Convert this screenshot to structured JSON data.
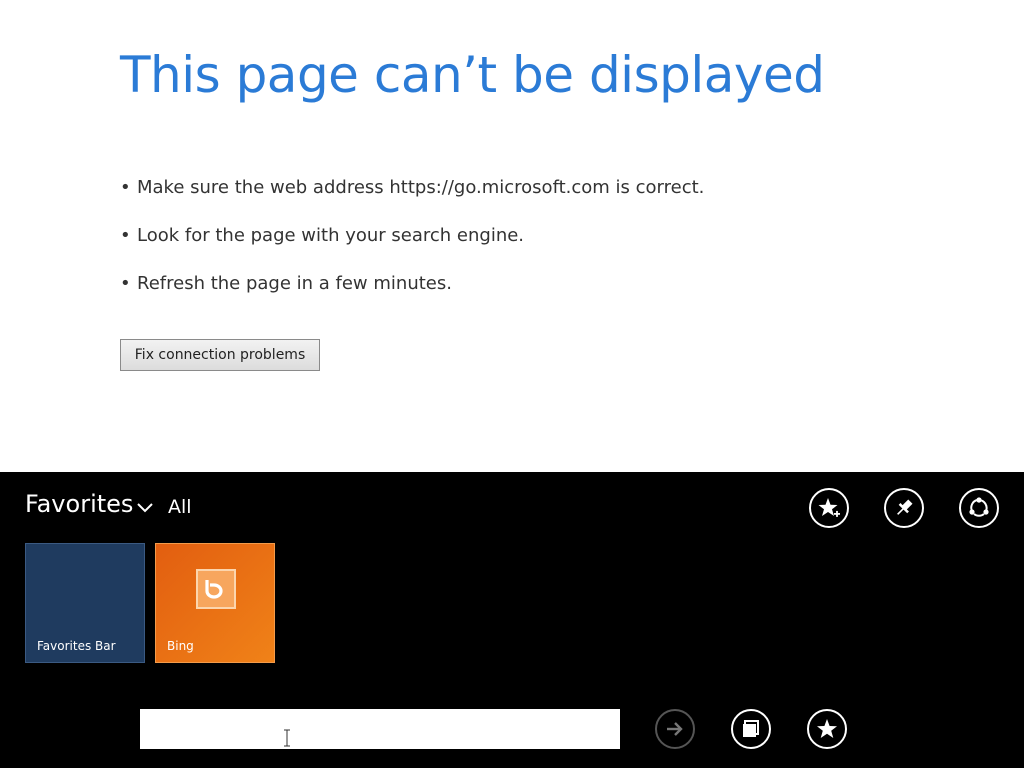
{
  "error": {
    "title": "This page can’t be displayed",
    "bullet": "•",
    "suggestions": [
      "Make sure the web address https://go.microsoft.com is correct.",
      "Look for the page with your search engine.",
      "Refresh the page in a few minutes."
    ],
    "fix_button_label": "Fix connection problems"
  },
  "favorites": {
    "title": "Favorites",
    "filter": "All",
    "tiles": [
      {
        "label": "Favorites Bar",
        "color": "#1f3b5f"
      },
      {
        "label": "Bing",
        "color": "#ea6a12",
        "icon": "bing-logo"
      }
    ]
  },
  "toolbar_top": {
    "icons": [
      "add-favorite-icon",
      "pin-icon",
      "share-icon"
    ]
  },
  "address_bar": {
    "value": "",
    "placeholder": "",
    "icons": [
      "go-arrow-icon",
      "tabs-icon",
      "favorites-icon"
    ]
  },
  "colors": {
    "title_blue": "#2b7bd6",
    "app_bar_bg": "#000000",
    "tile_blue": "#1f3b5f",
    "tile_orange": "#ea6a12"
  }
}
